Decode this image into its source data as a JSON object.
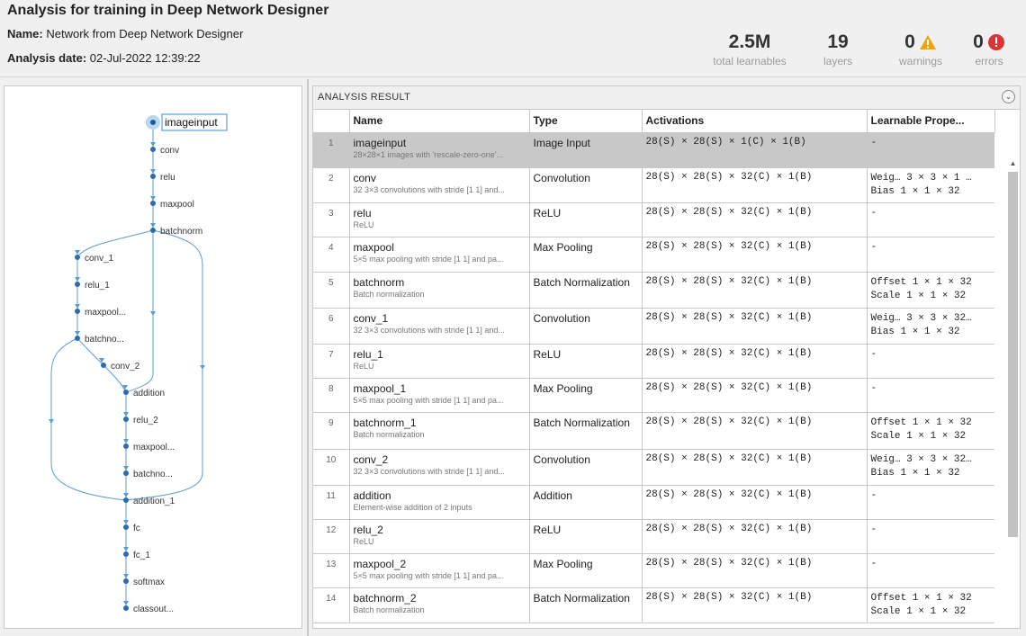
{
  "header": {
    "title": "Analysis for training in Deep Network Designer",
    "name_label": "Name:",
    "name_value": "Network from Deep Network Designer",
    "date_label": "Analysis date:",
    "date_value": "02-Jul-2022 12:39:22"
  },
  "stats": {
    "learnables": {
      "value": "2.5M",
      "label": "total learnables"
    },
    "layers": {
      "value": "19",
      "label": "layers"
    },
    "warnings": {
      "value": "0",
      "label": "warnings",
      "icon": "warning-triangle-icon",
      "color": "#f0a30a"
    },
    "errors": {
      "value": "0",
      "label": "errors",
      "icon": "error-circle-icon",
      "color": "#d93636"
    }
  },
  "graph": {
    "nodes": [
      "imageinput",
      "conv",
      "relu",
      "maxpool",
      "batchnorm",
      "conv_1",
      "relu_1",
      "maxpool...",
      "batchno...",
      "conv_2",
      "addition",
      "relu_2",
      "maxpool...",
      "batchno...",
      "addition_1",
      "fc",
      "fc_1",
      "softmax",
      "classout..."
    ]
  },
  "result": {
    "title": "ANALYSIS RESULT",
    "columns": [
      "Name",
      "Type",
      "Activations",
      "Learnable Prope..."
    ],
    "rows": [
      {
        "idx": "1",
        "name": "imageinput",
        "desc": "28×28×1 images with 'rescale-zero-one'...",
        "type": "Image Input",
        "act": "28(S) × 28(S) × 1(C) × 1(B)",
        "learn1": "-",
        "learn2": ""
      },
      {
        "idx": "2",
        "name": "conv",
        "desc": "32 3×3 convolutions with stride [1 1] and...",
        "type": "Convolution",
        "act": "28(S) × 28(S) × 32(C) × 1(B)",
        "learn1": "Weig…  3 × 3 × 1 …",
        "learn2": "Bias   1 × 1 × 32"
      },
      {
        "idx": "3",
        "name": "relu",
        "desc": "ReLU",
        "type": "ReLU",
        "act": "28(S) × 28(S) × 32(C) × 1(B)",
        "learn1": "-",
        "learn2": ""
      },
      {
        "idx": "4",
        "name": "maxpool",
        "desc": "5×5 max pooling with stride [1 1] and pa...",
        "type": "Max Pooling",
        "act": "28(S) × 28(S) × 32(C) × 1(B)",
        "learn1": "-",
        "learn2": ""
      },
      {
        "idx": "5",
        "name": "batchnorm",
        "desc": "Batch normalization",
        "type": "Batch Normalization",
        "act": "28(S) × 28(S) × 32(C) × 1(B)",
        "learn1": "Offset  1 × 1 × 32",
        "learn2": "Scale   1 × 1 × 32"
      },
      {
        "idx": "6",
        "name": "conv_1",
        "desc": "32 3×3 convolutions with stride [1 1] and...",
        "type": "Convolution",
        "act": "28(S) × 28(S) × 32(C) × 1(B)",
        "learn1": "Weig…  3 × 3 × 32…",
        "learn2": "Bias   1 × 1 × 32"
      },
      {
        "idx": "7",
        "name": "relu_1",
        "desc": "ReLU",
        "type": "ReLU",
        "act": "28(S) × 28(S) × 32(C) × 1(B)",
        "learn1": "-",
        "learn2": ""
      },
      {
        "idx": "8",
        "name": "maxpool_1",
        "desc": "5×5 max pooling with stride [1 1] and pa...",
        "type": "Max Pooling",
        "act": "28(S) × 28(S) × 32(C) × 1(B)",
        "learn1": "-",
        "learn2": ""
      },
      {
        "idx": "9",
        "name": "batchnorm_1",
        "desc": "Batch normalization",
        "type": "Batch Normalization",
        "act": "28(S) × 28(S) × 32(C) × 1(B)",
        "learn1": "Offset  1 × 1 × 32",
        "learn2": "Scale   1 × 1 × 32"
      },
      {
        "idx": "10",
        "name": "conv_2",
        "desc": "32 3×3 convolutions with stride [1 1] and...",
        "type": "Convolution",
        "act": "28(S) × 28(S) × 32(C) × 1(B)",
        "learn1": "Weig…  3 × 3 × 32…",
        "learn2": "Bias   1 × 1 × 32"
      },
      {
        "idx": "11",
        "name": "addition",
        "desc": "Element-wise addition of 2 inputs",
        "type": "Addition",
        "act": "28(S) × 28(S) × 32(C) × 1(B)",
        "learn1": "-",
        "learn2": ""
      },
      {
        "idx": "12",
        "name": "relu_2",
        "desc": "ReLU",
        "type": "ReLU",
        "act": "28(S) × 28(S) × 32(C) × 1(B)",
        "learn1": "-",
        "learn2": ""
      },
      {
        "idx": "13",
        "name": "maxpool_2",
        "desc": "5×5 max pooling with stride [1 1] and pa...",
        "type": "Max Pooling",
        "act": "28(S) × 28(S) × 32(C) × 1(B)",
        "learn1": "-",
        "learn2": ""
      },
      {
        "idx": "14",
        "name": "batchnorm_2",
        "desc": "Batch normalization",
        "type": "Batch Normalization",
        "act": "28(S) × 28(S) × 32(C) × 1(B)",
        "learn1": "Offset  1 × 1 × 32",
        "learn2": "Scale   1 × 1 × 32"
      }
    ]
  }
}
